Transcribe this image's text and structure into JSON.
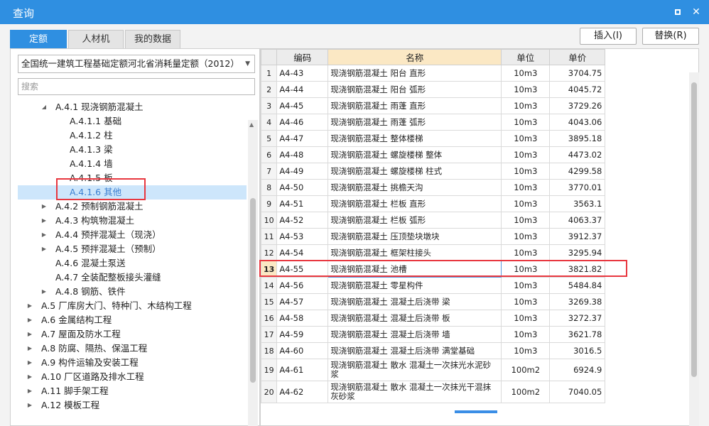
{
  "window": {
    "title": "查询"
  },
  "tabs": [
    {
      "label": "定额",
      "active": true
    },
    {
      "label": "人材机",
      "active": false
    },
    {
      "label": "我的数据",
      "active": false
    }
  ],
  "buttons": {
    "insert": "插入(I)",
    "replace": "替换(R)"
  },
  "library": {
    "selected": "全国统一建筑工程基础定额河北省消耗量定额（2012）"
  },
  "search": {
    "placeholder": "搜索"
  },
  "tree": [
    {
      "label": "A.4.1 现浇钢筋混凝土",
      "toggle": "◢",
      "level": 2,
      "selected": false
    },
    {
      "label": "A.4.1.1 基础",
      "toggle": "",
      "level": 3,
      "selected": false
    },
    {
      "label": "A.4.1.2 柱",
      "toggle": "",
      "level": 3,
      "selected": false
    },
    {
      "label": "A.4.1.3 梁",
      "toggle": "",
      "level": 3,
      "selected": false
    },
    {
      "label": "A.4.1.4 墙",
      "toggle": "",
      "level": 3,
      "selected": false
    },
    {
      "label": "A.4.1.5 板",
      "toggle": "",
      "level": 3,
      "selected": false
    },
    {
      "label": "A.4.1.6 其他",
      "toggle": "",
      "level": 3,
      "selected": true
    },
    {
      "label": "A.4.2 预制钢筋混凝土",
      "toggle": "▶",
      "level": 2,
      "selected": false
    },
    {
      "label": "A.4.3 构筑物混凝土",
      "toggle": "▶",
      "level": 2,
      "selected": false
    },
    {
      "label": "A.4.4 预拌混凝土（现浇）",
      "toggle": "▶",
      "level": 2,
      "selected": false
    },
    {
      "label": "A.4.5 预拌混凝土（预制）",
      "toggle": "▶",
      "level": 2,
      "selected": false
    },
    {
      "label": "A.4.6 混凝土泵送",
      "toggle": "",
      "level": 2,
      "selected": false
    },
    {
      "label": "A.4.7 全装配整板接头灌缝",
      "toggle": "",
      "level": 2,
      "selected": false
    },
    {
      "label": "A.4.8 钢筋、铁件",
      "toggle": "▶",
      "level": 2,
      "selected": false
    },
    {
      "label": "A.5 厂库房大门、特种门、木结构工程",
      "toggle": "▶",
      "level": 1,
      "selected": false
    },
    {
      "label": "A.6 金属结构工程",
      "toggle": "▶",
      "level": 1,
      "selected": false
    },
    {
      "label": "A.7 屋面及防水工程",
      "toggle": "▶",
      "level": 1,
      "selected": false
    },
    {
      "label": "A.8 防腐、隔热、保温工程",
      "toggle": "▶",
      "level": 1,
      "selected": false
    },
    {
      "label": "A.9 构件运输及安装工程",
      "toggle": "▶",
      "level": 1,
      "selected": false
    },
    {
      "label": "A.10 厂区道路及排水工程",
      "toggle": "▶",
      "level": 1,
      "selected": false
    },
    {
      "label": "A.11 脚手架工程",
      "toggle": "▶",
      "level": 1,
      "selected": false
    },
    {
      "label": "A.12 模板工程",
      "toggle": "▶",
      "level": 1,
      "selected": false
    }
  ],
  "table": {
    "headers": [
      "编码",
      "名称",
      "单位",
      "单价"
    ],
    "rows": [
      {
        "num": "1",
        "code": "A4-43",
        "name": "现浇钢筋混凝土 阳台 直形",
        "unit": "10m3",
        "price": "3704.75"
      },
      {
        "num": "2",
        "code": "A4-44",
        "name": "现浇钢筋混凝土 阳台 弧形",
        "unit": "10m3",
        "price": "4045.72"
      },
      {
        "num": "3",
        "code": "A4-45",
        "name": "现浇钢筋混凝土 雨蓬 直形",
        "unit": "10m3",
        "price": "3729.26"
      },
      {
        "num": "4",
        "code": "A4-46",
        "name": "现浇钢筋混凝土 雨蓬 弧形",
        "unit": "10m3",
        "price": "4043.06"
      },
      {
        "num": "5",
        "code": "A4-47",
        "name": "现浇钢筋混凝土 整体楼梯",
        "unit": "10m3",
        "price": "3895.18"
      },
      {
        "num": "6",
        "code": "A4-48",
        "name": "现浇钢筋混凝土 螺旋楼梯 整体",
        "unit": "10m3",
        "price": "4473.02"
      },
      {
        "num": "7",
        "code": "A4-49",
        "name": "现浇钢筋混凝土 螺旋楼梯 柱式",
        "unit": "10m3",
        "price": "4299.58"
      },
      {
        "num": "8",
        "code": "A4-50",
        "name": "现浇钢筋混凝土 挑檐天沟",
        "unit": "10m3",
        "price": "3770.01"
      },
      {
        "num": "9",
        "code": "A4-51",
        "name": "现浇钢筋混凝土 栏板 直形",
        "unit": "10m3",
        "price": "3563.1"
      },
      {
        "num": "10",
        "code": "A4-52",
        "name": "现浇钢筋混凝土 栏板 弧形",
        "unit": "10m3",
        "price": "4063.37"
      },
      {
        "num": "11",
        "code": "A4-53",
        "name": "现浇钢筋混凝土 压顶垫块墩块",
        "unit": "10m3",
        "price": "3912.37"
      },
      {
        "num": "12",
        "code": "A4-54",
        "name": "现浇钢筋混凝土 框架柱接头",
        "unit": "10m3",
        "price": "3295.94"
      },
      {
        "num": "13",
        "code": "A4-55",
        "name": "现浇钢筋混凝土 池槽",
        "unit": "10m3",
        "price": "3821.82"
      },
      {
        "num": "14",
        "code": "A4-56",
        "name": "现浇钢筋混凝土 零星构件",
        "unit": "10m3",
        "price": "5484.84"
      },
      {
        "num": "15",
        "code": "A4-57",
        "name": "现浇钢筋混凝土 混凝土后浇带 梁",
        "unit": "10m3",
        "price": "3269.38"
      },
      {
        "num": "16",
        "code": "A4-58",
        "name": "现浇钢筋混凝土 混凝土后浇带 板",
        "unit": "10m3",
        "price": "3272.37"
      },
      {
        "num": "17",
        "code": "A4-59",
        "name": "现浇钢筋混凝土 混凝土后浇带 墙",
        "unit": "10m3",
        "price": "3621.78"
      },
      {
        "num": "18",
        "code": "A4-60",
        "name": "现浇钢筋混凝土 混凝土后浇带 满堂基础",
        "unit": "10m3",
        "price": "3016.5"
      },
      {
        "num": "19",
        "code": "A4-61",
        "name": "现浇钢筋混凝土 散水 混凝土一次抹光水泥砂浆",
        "unit": "100m2",
        "price": "6924.9"
      },
      {
        "num": "20",
        "code": "A4-62",
        "name": "现浇钢筋混凝土 散水 混凝土一次抹光干混抹灰砂浆",
        "unit": "100m2",
        "price": "7040.05"
      }
    ]
  }
}
